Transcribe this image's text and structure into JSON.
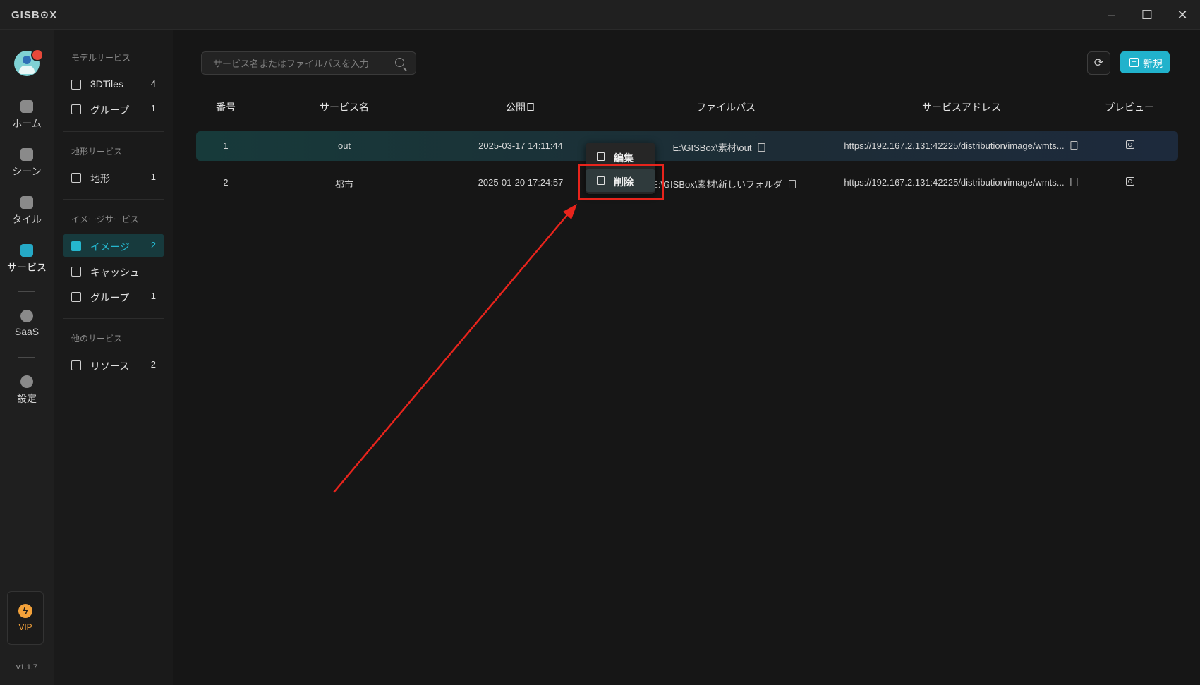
{
  "app": {
    "logo": "GISB⊙X",
    "window_controls": [
      "minimize-icon",
      "maximize-icon",
      "close-icon"
    ]
  },
  "rail": {
    "items": [
      {
        "label": "ホーム",
        "icon": "home-icon"
      },
      {
        "label": "シーン",
        "icon": "cube-icon"
      },
      {
        "label": "タイル",
        "icon": "tile-icon"
      },
      {
        "label": "サービス",
        "icon": "service-icon",
        "active": true
      },
      {
        "label": "SaaS",
        "icon": "lock-icon"
      },
      {
        "label": "設定",
        "icon": "gear-icon"
      }
    ],
    "vip_label": "VIP",
    "version": "v1.1.7"
  },
  "sidebar": {
    "sections": [
      {
        "title": "モデルサービス",
        "items": [
          {
            "label": "3DTiles",
            "count": "4"
          },
          {
            "label": "グループ",
            "count": "1"
          }
        ]
      },
      {
        "title": "地形サービス",
        "items": [
          {
            "label": "地形",
            "count": "1"
          }
        ]
      },
      {
        "title": "イメージサービス",
        "items": [
          {
            "label": "イメージ",
            "count": "2",
            "active": true
          },
          {
            "label": "キャッシュ",
            "count": ""
          },
          {
            "label": "グループ",
            "count": "1"
          }
        ]
      },
      {
        "title": "他のサービス",
        "items": [
          {
            "label": "リソース",
            "count": "2"
          }
        ]
      }
    ]
  },
  "toolbar": {
    "search_placeholder": "サービス名またはファイルパスを入力",
    "new_label": "新規"
  },
  "table": {
    "headers": [
      "番号",
      "サービス名",
      "公開日",
      "ファイルパス",
      "サービスアドレス",
      "プレビュー"
    ],
    "rows": [
      {
        "no": "1",
        "name": "out",
        "date": "2025-03-17 14:11:44",
        "path": "E:\\GISBox\\素材\\out",
        "address": "https://192.167.2.131:42225/distribution/image/wmts..."
      },
      {
        "no": "2",
        "name": "都市",
        "date": "2025-01-20 17:24:57",
        "path": "E:\\GISBox\\素材\\新しいフォルダ",
        "address": "https://192.167.2.131:42225/distribution/image/wmts..."
      }
    ]
  },
  "context_menu": {
    "edit_label": "編集",
    "delete_label": "削除"
  },
  "colors": {
    "accent": "#21b2cc",
    "annotation": "#e8241c",
    "vip": "#f2a13a"
  }
}
